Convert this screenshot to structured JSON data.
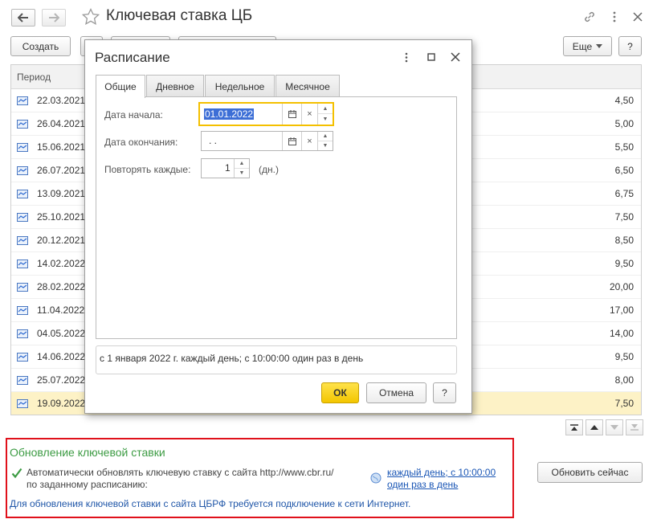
{
  "window": {
    "title": "Ключевая ставка ЦБ",
    "back_icon": "arrow-left-icon",
    "forward_icon": "arrow-right-icon",
    "favorite_icon": "star-icon",
    "link_icon": "link-icon",
    "menu_icon": "more-vert-icon",
    "close_icon": "close-icon"
  },
  "toolbar": {
    "create_label": "Создать",
    "more_label": "Еще",
    "help_label": "?"
  },
  "list": {
    "column_period": "Период",
    "rows": [
      {
        "date": "22.03.2021",
        "value": "4,50"
      },
      {
        "date": "26.04.2021",
        "value": "5,00"
      },
      {
        "date": "15.06.2021",
        "value": "5,50"
      },
      {
        "date": "26.07.2021",
        "value": "6,50"
      },
      {
        "date": "13.09.2021",
        "value": "6,75"
      },
      {
        "date": "25.10.2021",
        "value": "7,50"
      },
      {
        "date": "20.12.2021",
        "value": "8,50"
      },
      {
        "date": "14.02.2022",
        "value": "9,50"
      },
      {
        "date": "28.02.2022",
        "value": "20,00"
      },
      {
        "date": "11.04.2022",
        "value": "17,00"
      },
      {
        "date": "04.05.2022",
        "value": "14,00"
      },
      {
        "date": "14.06.2022",
        "value": "9,50"
      },
      {
        "date": "25.07.2022",
        "value": "8,00"
      },
      {
        "date": "19.09.2022",
        "value": "7,50",
        "selected": true
      }
    ]
  },
  "dialog": {
    "title": "Расписание",
    "tabs": [
      "Общие",
      "Дневное",
      "Недельное",
      "Месячное"
    ],
    "active_tab": "Общие",
    "start_date_label": "Дата начала:",
    "start_date_value": "01.01.2022",
    "end_date_label": "Дата окончания:",
    "end_date_value": " .  .",
    "repeat_label": "Повторять каждые:",
    "repeat_value": "1",
    "repeat_unit": "(дн.)",
    "summary": "с 1 января 2022 г. каждый день; с 10:00:00 один раз в день",
    "ok_label": "ОК",
    "cancel_label": "Отмена",
    "help_label": "?"
  },
  "update": {
    "section_title": "Обновление ключевой ставки",
    "auto_update_line1": "Автоматически обновлять ключевую ставку с сайта http://www.cbr.ru/",
    "auto_update_line2": "по заданному расписанию:",
    "auto_update_checked": true,
    "schedule_link_line1": "каждый день; с 10:00:00",
    "schedule_link_line2": "один раз в день",
    "update_now_label": "Обновить сейчас",
    "info_text": "Для обновления ключевой ставки с сайта ЦБРФ требуется подключение к сети Интернет."
  },
  "colors": {
    "highlight_border": "#e0111b",
    "section_title": "#3c9b43",
    "selected_row": "#fdf2c6",
    "ok_button": "#f3c600",
    "link": "#1a56b5"
  }
}
